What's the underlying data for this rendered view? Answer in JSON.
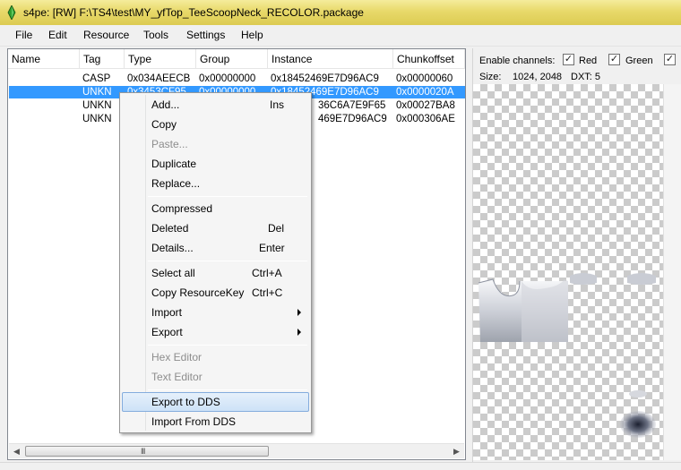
{
  "window": {
    "title": "s4pe: [RW] F:\\TS4\\test\\MY_yfTop_TeeScoopNeck_RECOLOR.package",
    "icon": "s4pe-app-icon"
  },
  "menu": [
    "File",
    "Edit",
    "Resource",
    "Tools",
    "Settings",
    "Help"
  ],
  "columns": [
    "Name",
    "Tag",
    "Type",
    "Group",
    "Instance",
    "Chunkoffset"
  ],
  "rows": [
    {
      "name": "",
      "tag": "CASP",
      "type": "0x034AEECB",
      "group": "0x00000000",
      "instance": "0x18452469E7D96AC9",
      "chunkoffset": "0x00000060"
    },
    {
      "name": "",
      "tag": "UNKN",
      "type": "0x3453CF95",
      "group": "0x00000000",
      "instance": "0x18452469E7D96AC9",
      "chunkoffset": "0x0000020A"
    },
    {
      "name": "",
      "tag": "UNKN",
      "type": "",
      "group": "",
      "instance": "36C6A7E9F65",
      "chunkoffset": "0x00027BA8"
    },
    {
      "name": "",
      "tag": "UNKN",
      "type": "",
      "group": "",
      "instance": "469E7D96AC9",
      "chunkoffset": "0x000306AE"
    }
  ],
  "scroll_grip": "III",
  "preview": {
    "enable_channels_label": "Enable channels:",
    "channels": [
      {
        "label": "Red",
        "checked": true
      },
      {
        "label": "Green",
        "checked": true
      },
      {
        "label": "",
        "checked": true
      }
    ],
    "size_label": "Size:",
    "size_value": "1024, 2048",
    "dxt_label": "DXT: 5"
  },
  "context_menu": {
    "items": [
      {
        "label": "Add...",
        "shortcut": "Ins"
      },
      {
        "label": "Copy",
        "shortcut": ""
      },
      {
        "label": "Paste...",
        "shortcut": "",
        "disabled": true
      },
      {
        "label": "Duplicate",
        "shortcut": ""
      },
      {
        "label": "Replace...",
        "shortcut": ""
      },
      {
        "label": "Compressed",
        "shortcut": ""
      },
      {
        "label": "Deleted",
        "shortcut": "Del"
      },
      {
        "label": "Details...",
        "shortcut": "Enter"
      },
      {
        "label": "Select all",
        "shortcut": "Ctrl+A"
      },
      {
        "label": "Copy ResourceKey",
        "shortcut": "Ctrl+C"
      },
      {
        "label": "Import",
        "shortcut": "",
        "submenu": true
      },
      {
        "label": "Export",
        "shortcut": "",
        "submenu": true
      },
      {
        "label": "Hex Editor",
        "shortcut": "",
        "disabled": true
      },
      {
        "label": "Text Editor",
        "shortcut": "",
        "disabled": true
      },
      {
        "label": "Export to DDS",
        "shortcut": "",
        "highlighted": true
      },
      {
        "label": "Import From DDS",
        "shortcut": ""
      }
    ]
  },
  "colors": {
    "title_bar": "#e8d96a",
    "selection": "#3399ff",
    "menu_highlight": "#cde2f7"
  }
}
